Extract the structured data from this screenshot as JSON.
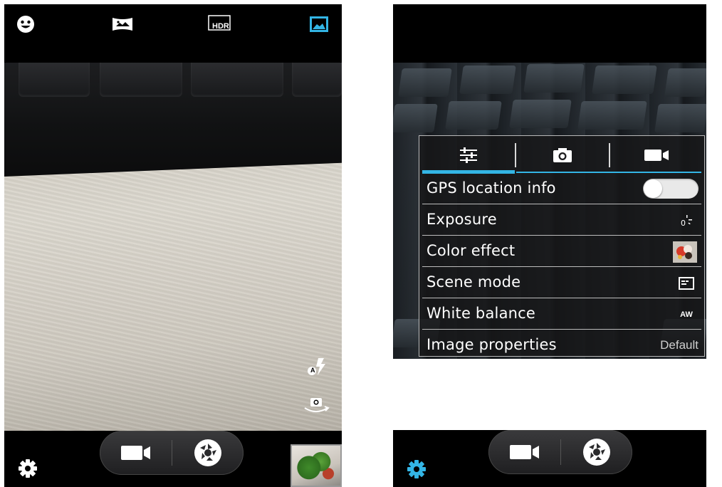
{
  "left_screen": {
    "top_bar": {
      "icons": [
        "face-detection-icon",
        "panorama-icon",
        "hdr-icon",
        "picture-mode-icon"
      ],
      "hdr_label": "HDR"
    },
    "side_controls": {
      "flash": "flash-auto-icon",
      "flash_badge": "A",
      "switch_camera": "switch-camera-icon"
    },
    "bottom_bar": {
      "video_button": "video-camera-icon",
      "shutter_button": "shutter-icon",
      "settings": "gear-icon",
      "thumbnail": "gallery-thumbnail"
    }
  },
  "right_screen": {
    "settings_menu": {
      "tabs": [
        {
          "icon": "sliders-icon",
          "active": true
        },
        {
          "icon": "camera-icon",
          "active": false
        },
        {
          "icon": "video-camera-icon",
          "active": false
        }
      ],
      "rows": [
        {
          "label": "GPS location info",
          "control": "toggle",
          "toggle_on": false
        },
        {
          "label": "Exposure",
          "control": "icon",
          "icon": "exposure-icon"
        },
        {
          "label": "Color effect",
          "control": "icon",
          "icon": "color-effect-thumbnail-icon"
        },
        {
          "label": "Scene mode",
          "control": "icon",
          "icon": "scene-mode-icon"
        },
        {
          "label": "White balance",
          "control": "icon",
          "icon": "white-balance-auto-icon",
          "icon_text": "AW"
        },
        {
          "label": "Image properties",
          "control": "value",
          "value": "Default"
        }
      ]
    },
    "bottom_bar": {
      "video_button": "video-camera-icon",
      "shutter_button": "shutter-icon",
      "settings": "gear-icon"
    }
  },
  "colors": {
    "accent": "#33b5e5",
    "bar_background": "#000000",
    "menu_text": "#ffffff"
  }
}
